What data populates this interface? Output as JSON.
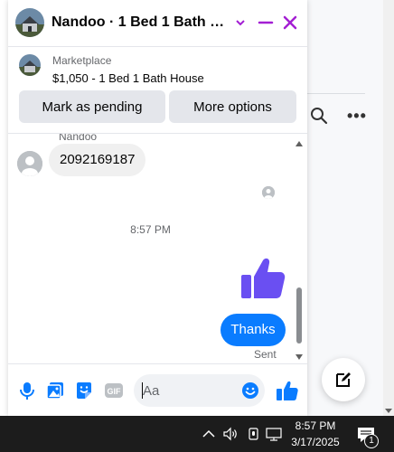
{
  "chat": {
    "title": "Nandoo · 1 Bed 1 Bath Hou···",
    "listing": {
      "source": "Marketplace",
      "title": "$1,050 - 1 Bed 1 Bath House"
    },
    "buttons": {
      "mark_pending": "Mark as pending",
      "more_options": "More options"
    },
    "messages": {
      "sender_name": "Nandoo",
      "received_text": "2092169187",
      "timestamp": "8:57 PM",
      "sent_text": "Thanks",
      "sent_status": "Sent"
    },
    "composer": {
      "placeholder": "Aa"
    }
  },
  "colors": {
    "accent": "#0a7cff",
    "header_icons": "#a31fd3",
    "thumb_large": "#6a4ff2"
  },
  "taskbar": {
    "time": "8:57 PM",
    "date": "3/17/2025",
    "notification_count": "1"
  }
}
